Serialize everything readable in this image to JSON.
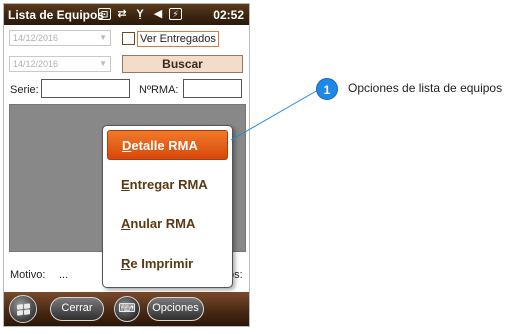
{
  "titlebar": {
    "title": "Lista de Equipos",
    "clock": "02:52",
    "icons": [
      "start-task-icon",
      "sync-arrows-icon",
      "no-signal-icon",
      "mute-speaker-icon",
      "battery-charging-icon"
    ]
  },
  "filters": {
    "date_from": "14/12/2016",
    "date_to": "14/12/2016",
    "ver_entregados_label": "Ver Entregados",
    "ver_entregados_checked": false,
    "buscar_label": "Buscar",
    "serie_label": "Serie:",
    "serie_value": "",
    "nrma_label": "NºRMA:",
    "nrma_value": ""
  },
  "footer_info": {
    "motivo_label": "Motivo:",
    "motivo_value": "...",
    "partial_label": "os:"
  },
  "context_menu": {
    "items": [
      {
        "accel": "D",
        "rest": "etalle RMA",
        "selected": true
      },
      {
        "accel": "E",
        "rest": "ntregar RMA",
        "selected": false
      },
      {
        "accel": "A",
        "rest": "nular RMA",
        "selected": false
      },
      {
        "accel": "R",
        "rest": "e Imprimir",
        "selected": false
      }
    ]
  },
  "bottombar": {
    "cerrar_label": "Cerrar",
    "opciones_label": "Opciones"
  },
  "annotation": {
    "number": "1",
    "text": "Opciones de lista de equipos",
    "color": "#1e88e5"
  },
  "colors": {
    "accent_orange": "#e0600f",
    "titlebar_brown": "#3a2410",
    "menu_text": "#5a3a14"
  }
}
